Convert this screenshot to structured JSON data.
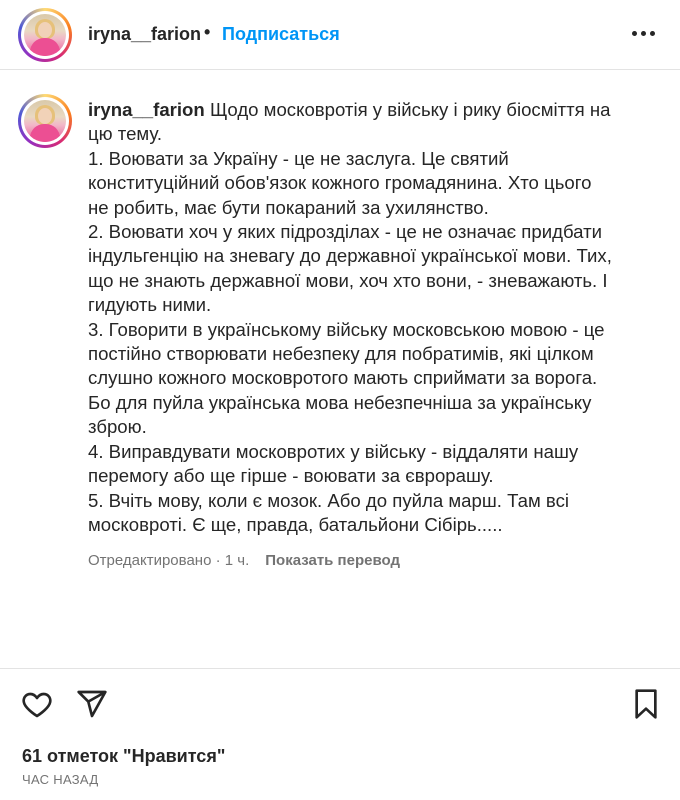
{
  "header": {
    "username": "iryna__farion",
    "separator": "•",
    "follow_label": "Подписаться",
    "more_icon": "more-horizontal-icon"
  },
  "post": {
    "caption_username": "iryna__farion",
    "caption_lines": [
      "Щодо московротія у війську і рику біосміття на",
      "цю тему.",
      "1. Воювати за Україну - це не заслуга. Це святий",
      "конституційний обов'язок кожного громадянина. Хто цього",
      "не робить, має бути покараний за ухилянство.",
      "2. Воювати хоч у яких підрозділах - це не означає придбати",
      "індульгенцію на зневагу до державної української мови. Тих,",
      "що не знають державної мови, хоч хто вони, - зневажають. І",
      "гидують ними.",
      "3. Говорити в українському війську московською мовою - це",
      "постійно створювати небезпеку для побратимів, які цілком",
      "слушно кожного московротого мають сприймати за ворога.",
      "Бо для пуйла українська мова небезпечніша за українську",
      "зброю.",
      "4. Виправдувати московротих у війську - віддаляти нашу",
      "перемогу або ще гірше - воювати за єврорашу.",
      "5. Вчіть мову, коли є мозок. Або до пуйла марш. Там всі",
      "московроті. Є ще, правда, батальйони Сібірь....."
    ],
    "edited_label": "Отредактировано · 1 ч.",
    "translate_label": "Показать перевод"
  },
  "actions": {
    "like_icon": "heart-icon",
    "share_icon": "send-icon",
    "save_icon": "bookmark-icon"
  },
  "footer": {
    "likes_text": "61 отметок \"Нравится\"",
    "time_text": "ЧАС НАЗАД"
  },
  "colors": {
    "accent": "#0095f6",
    "text": "#262626",
    "muted": "#737373",
    "divider": "#e3e3e3"
  }
}
